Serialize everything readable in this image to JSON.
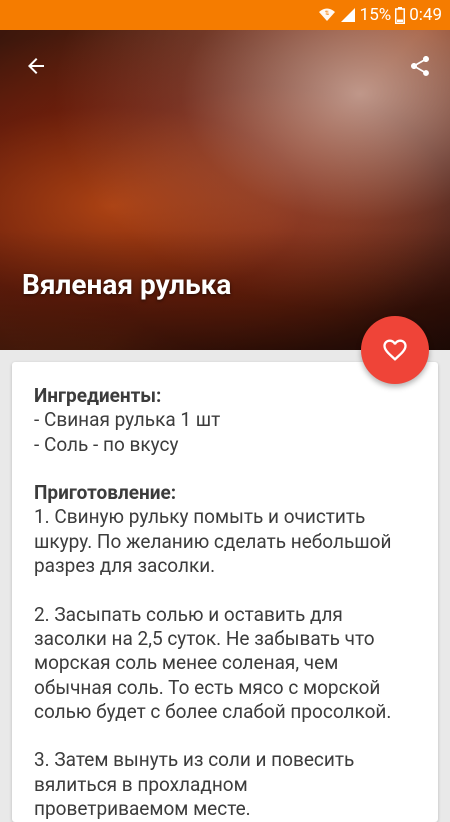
{
  "status_bar": {
    "battery_percent": "15%",
    "time": "0:49",
    "icons": [
      "wifi-icon",
      "signal-icon",
      "battery-icon"
    ],
    "background": "#f57c00"
  },
  "toolbar": {
    "back_icon": "arrow-left-icon",
    "share_icon": "share-icon"
  },
  "recipe": {
    "title": "Вяленая рулька",
    "ingredients_heading": "Ингредиенты:",
    "ingredients": [
      "- Свиная рулька 1 шт",
      "- Соль - по вкусу"
    ],
    "preparation_heading": "Приготовление:",
    "preparation_lines": [
      "1. Свиную рульку помыть и очистить",
      "шкуру. По желанию сделать небольшой",
      "разрез для засолки.",
      "",
      "2. Засыпать солью и оставить для",
      "засолки на 2,5 суток. Не забывать что",
      "морская соль менее соленая, чем",
      "обычная соль. То есть мясо с морской",
      "солью будет с более слабой просолкой.",
      "",
      "3. Затем вынуть из соли и повесить",
      "вялиться в прохладном",
      "проветриваемом месте."
    ]
  },
  "fab": {
    "icon": "heart-outline-icon",
    "color": "#ef4438"
  }
}
